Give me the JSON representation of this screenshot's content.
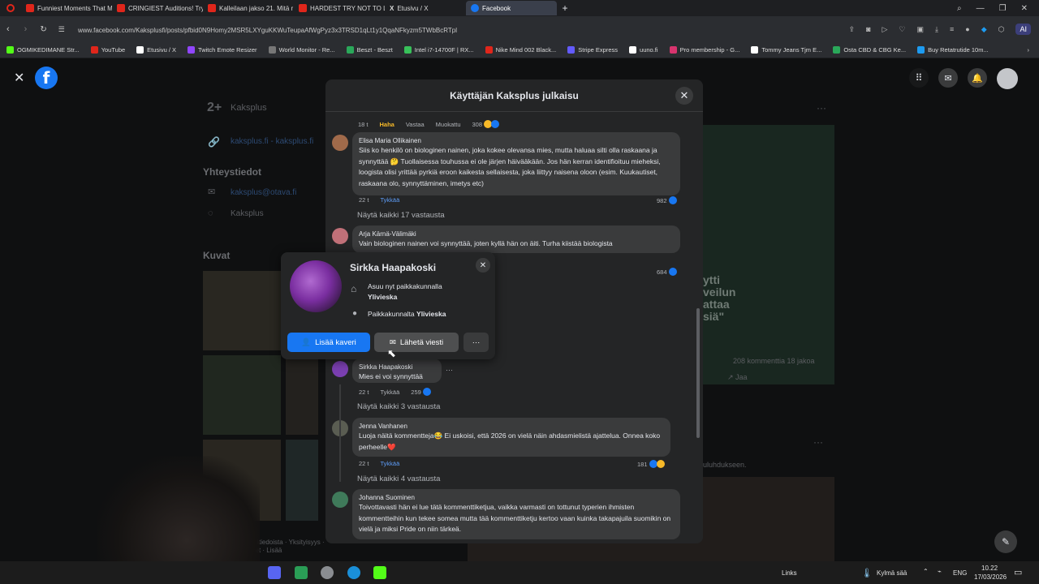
{
  "browser": {
    "tabs": [
      {
        "label": "Funniest Moments That M",
        "color": "#e0261b"
      },
      {
        "label": "CRINGIEST Auditions! Try",
        "color": "#e0261b"
      },
      {
        "label": "Kalleilaan jakso 21. Mitä r",
        "color": "#e0261b"
      },
      {
        "label": "HARDEST TRY NOT TO LA",
        "color": "#e0261b"
      },
      {
        "label": "Etusivu / X",
        "color": "#ffffff"
      },
      {
        "label": "Facebook",
        "color": "#1877f2"
      }
    ],
    "new_tab": "+",
    "url": "www.facebook.com/Kaksplusfi/posts/pfbid0N9Homy2MSR5LXYguKKWuTeupaAfWgPyz3x3TRSD1qLt1y1QqaNFkyzm5TWbBcRTpl",
    "bookmarks": [
      {
        "label": "OGMIKEDIMANE Str...",
        "color": "#53fc18"
      },
      {
        "label": "YouTube",
        "color": "#e0261b"
      },
      {
        "label": "Etusivu / X",
        "color": "#ffffff"
      },
      {
        "label": "Twitch Emote Resizer",
        "color": "#9146ff"
      },
      {
        "label": "World Monitor - Re...",
        "color": "#777777"
      },
      {
        "label": "Beszt - Beszt",
        "color": "#2aa85a"
      },
      {
        "label": "Intel i7-14700F | RX...",
        "color": "#38c15a"
      },
      {
        "label": "Nike Mind 002 Black...",
        "color": "#e0261b"
      },
      {
        "label": "Stripe Express",
        "color": "#635bff"
      },
      {
        "label": "uuno.fi",
        "color": "#ffffff"
      },
      {
        "label": "Pro membership - G...",
        "color": "#d8346e"
      },
      {
        "label": "Tommy Jeans Tjm E...",
        "color": "#ffffff"
      },
      {
        "label": "Osta CBD & CBG Ke...",
        "color": "#2aa85a"
      },
      {
        "label": "Buy Retatrutide 10m...",
        "color": "#1d9bf0"
      }
    ],
    "ai_label": "AI"
  },
  "background": {
    "profile_name": "Kaksplus",
    "website": "kaksplus.fi - kaksplus.fi",
    "contact_heading": "Yhteystiedot",
    "email": "kaksplus@otava.fi",
    "profile_link": "Kaksplus",
    "photos_heading": "Kuvat",
    "post_overlay": "ytti\nveilun\nattaa\nsiä\"",
    "post_stats": "208 kommenttia  18 jakoa",
    "share": "Jaa",
    "right_hint": "uluhdukseen.",
    "footer": "Käyttäjätiedoista · Yksityisyys · Evästeet · Lisää"
  },
  "modal": {
    "title": "Käyttäjän Kaksplus julkaisu",
    "top_meta": {
      "time": "18 t",
      "reaction": "Haha",
      "reply": "Vastaa",
      "edited": "Muokattu",
      "count": "308"
    },
    "comments": [
      {
        "name": "Elisa Maria Ollikainen",
        "text": "Siis ko henkilö on biologinen nainen, joka kokee olevansa mies, mutta haluaa silti olla raskaana ja synnyttää 🤔 Tuollaisessa touhussa ei ole järjen häivääkään. Jos hän kerran identifioituu mieheksi, loogista olisi yrittää pyrkiä eroon kaikesta sellaisesta, joka liittyy naisena oloon (esim. Kuukautiset, raskaana olo, synnyttäminen, imetys etc)",
        "time": "22 t",
        "like": "Tykkää",
        "count": "982"
      },
      {
        "name": "Arja Kärnä-Välimäki",
        "text": "Vain biologinen nainen voi synnyttää, joten kyllä hän on äiti. Turha kiistää biologista",
        "count": "684"
      },
      {
        "name": "Sirkka Haapakoski",
        "text": "Mies ei voi synnyttää",
        "time": "22 t",
        "like": "Tykkää",
        "count": "259"
      },
      {
        "name": "Jenna Vanhanen",
        "text": "Luoja näitä kommentteja😂 Ei uskoisi, että 2026 on vielä näin ahdasmielistä ajattelua. Onnea koko perheelle❤️",
        "time": "22 t",
        "like": "Tykkää",
        "count": "181"
      },
      {
        "name": "Johanna Suominen",
        "text": "Toivottavasti hän ei lue tätä kommenttiketjua, vaikka varmasti on tottunut typerien ihmisten kommentteihin kun tekee somea mutta tää kommenttiketju kertoo vaan kuinka takapajuila suomikin on vielä ja miksi Pride on niin tärkeä."
      }
    ],
    "show_replies": [
      "Näytä kaikki 17 vastausta",
      "Näytä kaikki 3 vastausta",
      "Näytä kaikki 4 vastausta"
    ]
  },
  "hovercard": {
    "name": "Sirkka Haapakoski",
    "lives_label": "Asuu nyt paikkakunnalla",
    "lives_city": "Ylivieska",
    "from_label": "Paikkakunnalta",
    "from_city": "Ylivieska",
    "add_friend": "Lisää kaveri",
    "message": "Lähetä viesti",
    "more": "···"
  },
  "taskbar": {
    "links": "Links",
    "weather": "Kylmä sää",
    "lang": "ENG",
    "time": "10.22",
    "date": "17/03/2026"
  }
}
